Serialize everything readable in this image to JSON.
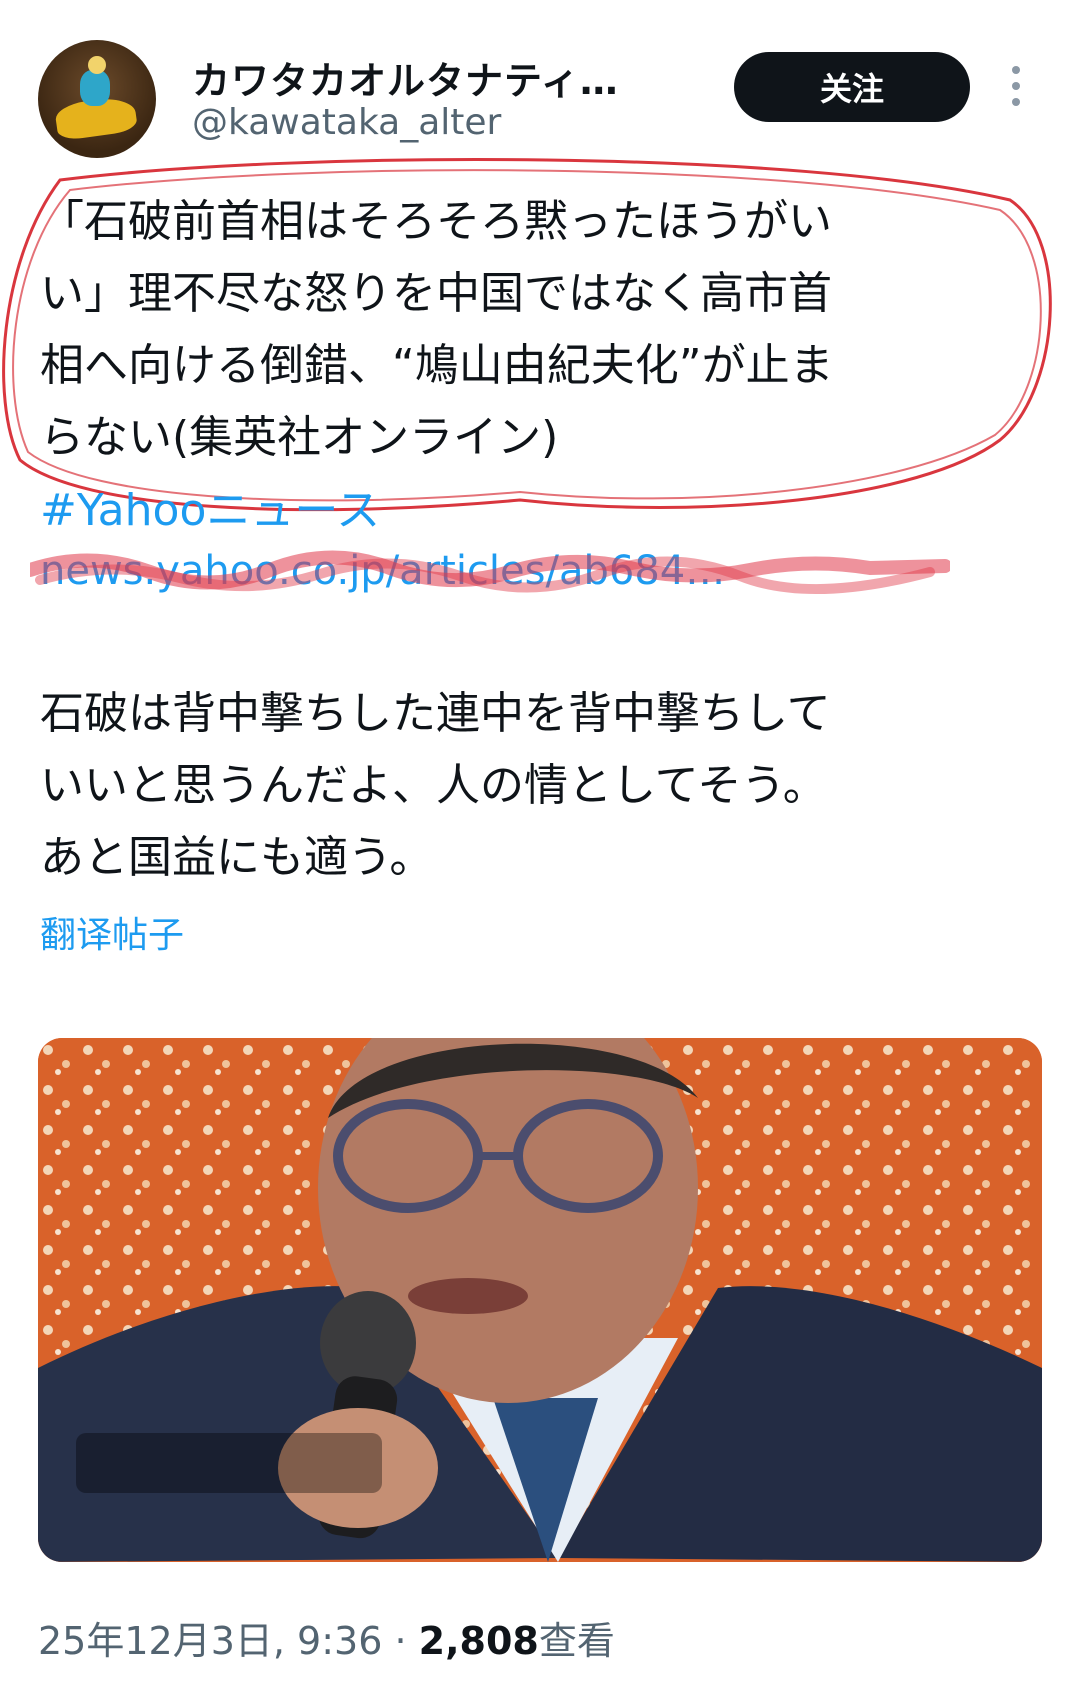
{
  "user": {
    "display_name": "カワタカオルタナティ…",
    "handle": "@kawataka_alter",
    "avatar_icon": "avatar-jockey-icon"
  },
  "header": {
    "follow_label": "关注",
    "more_icon": "more-vertical-icon"
  },
  "tweet": {
    "quote_lines": [
      "「石破前首相はそろそろ黙ったほうがい",
      "い」理不尽な怒りを中国ではなく高市首",
      "相へ向ける倒錯、“鳩山由紀夫化”が止ま",
      "らない(集英社オンライン)"
    ],
    "hashtag": "#Yahooニュース",
    "link": "news.yahoo.co.jp/articles/ab684…",
    "comment_lines": [
      "石破は背中撃ちした連中を背中撃ちして",
      "いいと思うんだよ、人の情としてそう。",
      "あと国益にも適う。"
    ],
    "translate_label": "翻译帖子"
  },
  "media": {
    "type": "photo"
  },
  "footer": {
    "timestamp": "25年12月3日, 9:36 · ",
    "views_count": "2,808",
    "views_label": "查看"
  },
  "colors": {
    "accent": "#1d9bf0",
    "text": "#0f1419",
    "muted": "#536471",
    "annotation": "#d9363e"
  }
}
